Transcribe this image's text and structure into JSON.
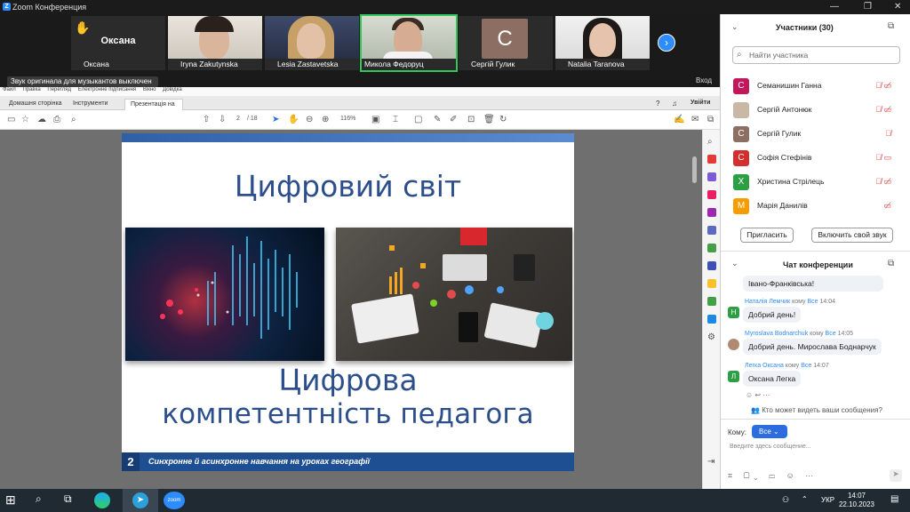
{
  "window": {
    "title": "Zoom Конференция"
  },
  "participants_strip": [
    {
      "name": "Оксана",
      "big_label": "Оксана"
    },
    {
      "name": "Iryna Zakutynska"
    },
    {
      "name": "Lesia Zastavetska"
    },
    {
      "name": "Микола Федоруц"
    },
    {
      "name": "Сергій Гулик",
      "initial": "С"
    },
    {
      "name": "Natalia Taranova"
    }
  ],
  "notice": "Звук оригинала для музыкантов выключен",
  "entry_label": "Вход",
  "app": {
    "menu": [
      "Файл",
      "Правка",
      "Перегляд",
      "Електронне підписання",
      "Вікно",
      "Довідка"
    ],
    "tabs": [
      "Домашня сторінка",
      "Інструменти",
      "Презентація на фо..."
    ],
    "signin": "Увійти",
    "page_current": "2",
    "page_total": "/ 18",
    "zoom": "116%"
  },
  "slide": {
    "title": "Цифровий світ",
    "subtitle_line1": "Цифрова",
    "subtitle_line2": "компетентність педагога",
    "number": "2",
    "footer": "Синхронне й асинхронне навчання на уроках географії"
  },
  "panel": {
    "participants_header": "Участники (30)",
    "search_placeholder": "Найти участника",
    "participants": [
      {
        "initial": "С",
        "name": "Семанишин Ганна",
        "color": "#c2185b"
      },
      {
        "initial": "",
        "name": "Сергій Антонюк",
        "color": "#c9b8a6"
      },
      {
        "initial": "С",
        "name": "Сергій Гулик",
        "color": "#8d6e63"
      },
      {
        "initial": "С",
        "name": "Софія Стефінів",
        "color": "#d32f2f"
      },
      {
        "initial": "Х",
        "name": "Христина Стрілець",
        "color": "#2e9e45"
      },
      {
        "initial": "М",
        "name": "Марія Данилів",
        "color": "#f59c00"
      }
    ],
    "invite_button": "Пригласить",
    "unmute_button": "Включить свой звук",
    "chat_header": "Чат конференции",
    "messages": [
      {
        "sender": "",
        "to": "",
        "time": "",
        "text": "Івано-Франківська!"
      },
      {
        "sender": "Наталія Лемчик",
        "to": "Все",
        "time": "14:04",
        "text": "Добрий день!",
        "initial": "Н",
        "color": "#2e9e45"
      },
      {
        "sender": "Myroslava Bodnarchuk",
        "to": "Все",
        "time": "14:05",
        "text": "Добрий день. Мирослава Боднарчук",
        "initial": "",
        "color": "#b08a70"
      },
      {
        "sender": "Легка Оксана",
        "to": "Все",
        "time": "14:07",
        "text": "Оксана Легка",
        "initial": "Л",
        "color": "#2e9e45"
      }
    ],
    "to_word": "кому",
    "who_can_see": "Кто может видеть ваши сообщения?",
    "to_label": "Кому:",
    "to_value": "Все",
    "input_placeholder": "Введите здесь сообщение..."
  },
  "taskbar": {
    "zoom_label": "zoom",
    "lang": "УКР",
    "time": "14:07",
    "date": "22.10.2023"
  }
}
